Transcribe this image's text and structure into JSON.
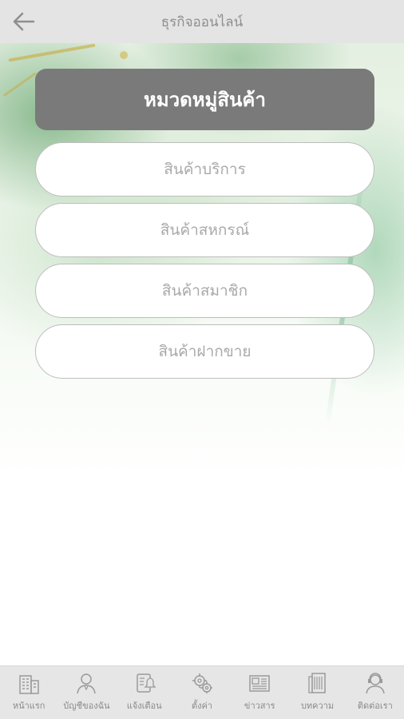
{
  "header": {
    "title": "ธุรกิจออนไลน์"
  },
  "category": {
    "title": "หมวดหมู่สินค้า",
    "items": [
      {
        "label": "สินค้าบริการ"
      },
      {
        "label": "สินค้าสหกรณ์"
      },
      {
        "label": "สินค้าสมาชิก"
      },
      {
        "label": "สินค้าฝากขาย"
      }
    ]
  },
  "tabbar": {
    "items": [
      {
        "label": "หน้าแรก",
        "icon": "building-icon"
      },
      {
        "label": "บัญชีของฉัน",
        "icon": "user-icon"
      },
      {
        "label": "แจ้งเตือน",
        "icon": "notification-icon"
      },
      {
        "label": "ตั้งค่า",
        "icon": "gear-icon"
      },
      {
        "label": "ข่าวสาร",
        "icon": "newspaper-icon"
      },
      {
        "label": "บทความ",
        "icon": "article-icon"
      },
      {
        "label": "ติดต่อเรา",
        "icon": "contact-icon"
      }
    ]
  }
}
